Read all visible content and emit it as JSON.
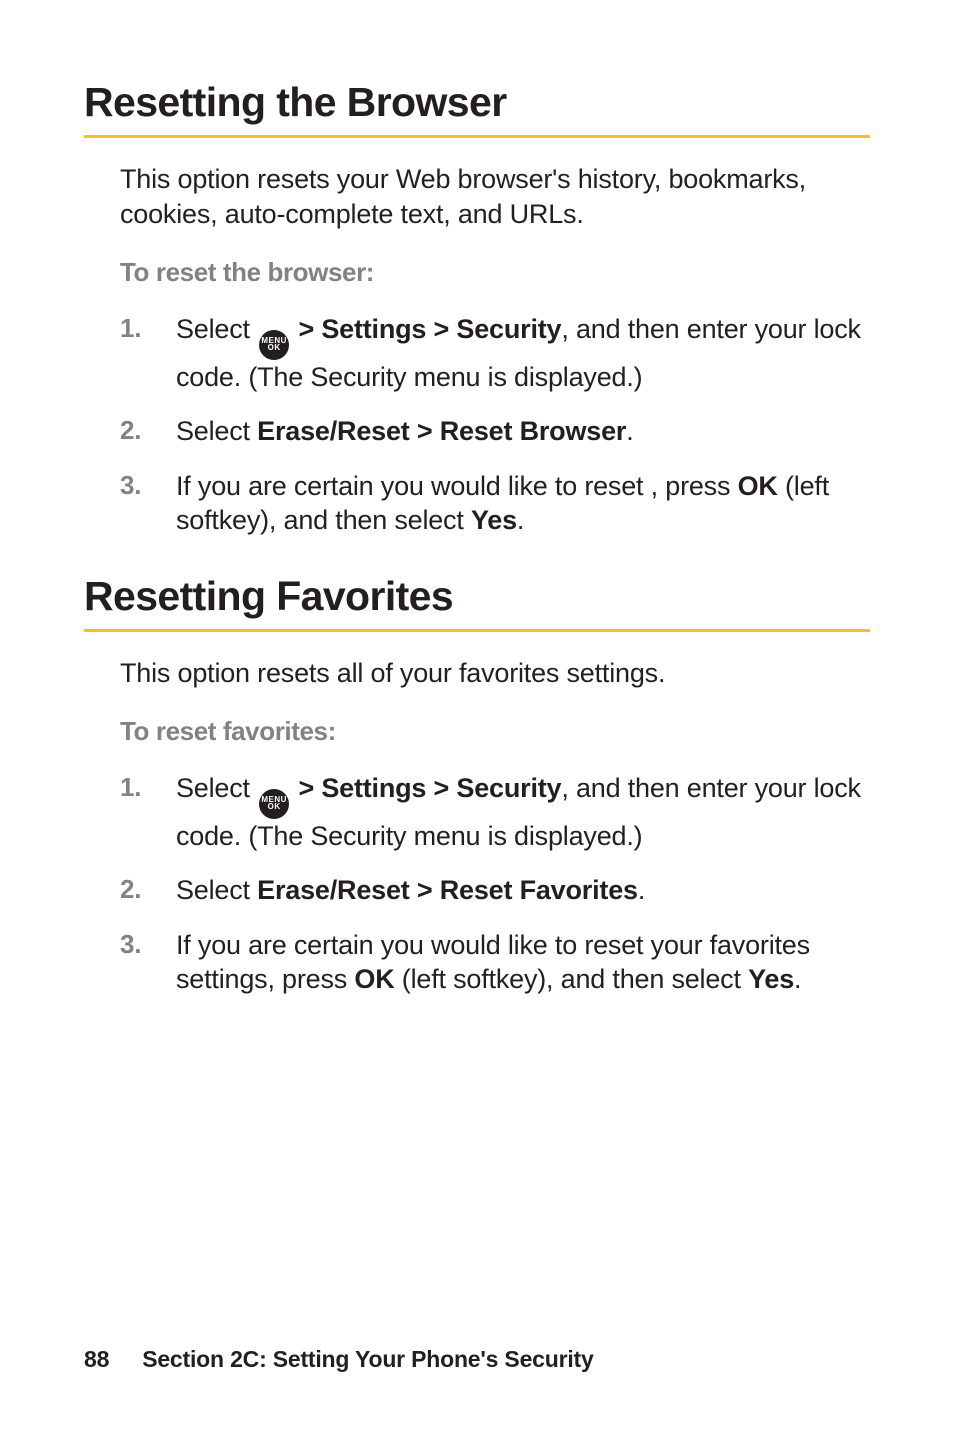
{
  "sections": [
    {
      "heading": "Resetting the Browser",
      "intro": "This option resets your Web browser's history, bookmarks, cookies, auto-complete text, and URLs.",
      "subhead": "To reset the browser:",
      "steps": [
        {
          "num": "1.",
          "pre": "Select ",
          "icon": {
            "top": "MENU",
            "bottom": "OK"
          },
          "mid1_bold": " > Settings > Security",
          "mid1_plain": ", and then enter your lock code. (The Security menu is displayed.)"
        },
        {
          "num": "2.",
          "pre": "Select ",
          "mid1_bold": "Erase/Reset > Reset Browser",
          "mid1_plain": "."
        },
        {
          "num": "3.",
          "pre": "If you are certain you would like to reset , press ",
          "mid1_bold": "OK",
          "mid1_plain": " (left softkey), and then select ",
          "mid2_bold": "Yes",
          "mid2_plain": "."
        }
      ]
    },
    {
      "heading": "Resetting Favorites",
      "intro": "This option resets all of your favorites settings.",
      "subhead": "To reset favorites:",
      "steps": [
        {
          "num": "1.",
          "pre": "Select ",
          "icon": {
            "top": "MENU",
            "bottom": "OK"
          },
          "mid1_bold": " > Settings > Security",
          "mid1_plain": ", and then enter your lock code. (The Security menu is displayed.)"
        },
        {
          "num": "2.",
          "pre": "Select ",
          "mid1_bold": "Erase/Reset > Reset Favorites",
          "mid1_plain": "."
        },
        {
          "num": "3.",
          "pre": "If you are certain you would like to reset your favorites settings, press ",
          "mid1_bold": "OK",
          "mid1_plain": " (left softkey), and then select ",
          "mid2_bold": "Yes",
          "mid2_plain": "."
        }
      ]
    }
  ],
  "footer": {
    "page_number": "88",
    "section_label": "Section 2C: Setting Your Phone's Security"
  }
}
